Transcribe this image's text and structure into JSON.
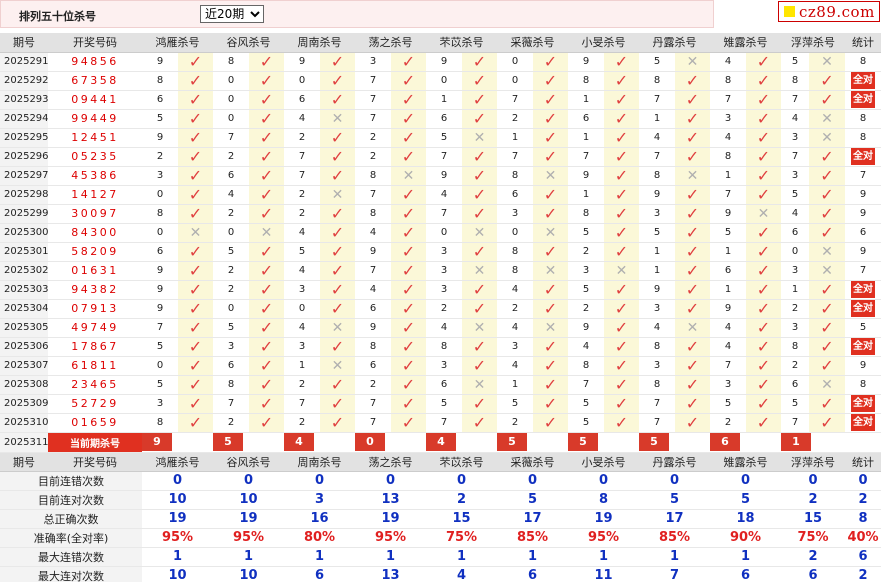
{
  "header": {
    "title": "排列五十位杀号",
    "range_select": "近20期"
  },
  "logo": {
    "text": "cz89.com"
  },
  "columns": [
    "期号",
    "开奖号码",
    "鸿雁杀号",
    "谷风杀号",
    "周南杀号",
    "荡之杀号",
    "芣苡杀号",
    "采薇杀号",
    "小旻杀号",
    "丹露杀号",
    "雉露杀号",
    "浮萍杀号",
    "统计"
  ],
  "all_correct_label": "全对",
  "rows": [
    {
      "period": "2025291",
      "draw": "94856",
      "cells": [
        [
          9,
          1
        ],
        [
          8,
          1
        ],
        [
          9,
          1
        ],
        [
          3,
          1
        ],
        [
          9,
          1
        ],
        [
          0,
          1
        ],
        [
          9,
          1
        ],
        [
          5,
          0
        ],
        [
          4,
          1
        ],
        [
          5,
          0
        ]
      ],
      "tally": "8"
    },
    {
      "period": "2025292",
      "draw": "67358",
      "cells": [
        [
          8,
          1
        ],
        [
          0,
          1
        ],
        [
          0,
          1
        ],
        [
          7,
          1
        ],
        [
          0,
          1
        ],
        [
          0,
          1
        ],
        [
          8,
          1
        ],
        [
          8,
          1
        ],
        [
          8,
          1
        ],
        [
          8,
          1
        ]
      ],
      "tally": "全对"
    },
    {
      "period": "2025293",
      "draw": "09441",
      "cells": [
        [
          6,
          1
        ],
        [
          0,
          1
        ],
        [
          6,
          1
        ],
        [
          7,
          1
        ],
        [
          1,
          1
        ],
        [
          7,
          1
        ],
        [
          1,
          1
        ],
        [
          7,
          1
        ],
        [
          7,
          1
        ],
        [
          7,
          1
        ]
      ],
      "tally": "全对"
    },
    {
      "period": "2025294",
      "draw": "99449",
      "cells": [
        [
          5,
          1
        ],
        [
          0,
          1
        ],
        [
          4,
          0
        ],
        [
          7,
          1
        ],
        [
          6,
          1
        ],
        [
          2,
          1
        ],
        [
          6,
          1
        ],
        [
          1,
          1
        ],
        [
          3,
          1
        ],
        [
          4,
          0
        ]
      ],
      "tally": "8"
    },
    {
      "period": "2025295",
      "draw": "12451",
      "cells": [
        [
          9,
          1
        ],
        [
          7,
          1
        ],
        [
          2,
          1
        ],
        [
          2,
          1
        ],
        [
          5,
          0
        ],
        [
          1,
          1
        ],
        [
          1,
          1
        ],
        [
          4,
          1
        ],
        [
          4,
          1
        ],
        [
          3,
          0
        ]
      ],
      "tally": "8"
    },
    {
      "period": "2025296",
      "draw": "05235",
      "cells": [
        [
          2,
          1
        ],
        [
          2,
          1
        ],
        [
          7,
          1
        ],
        [
          2,
          1
        ],
        [
          7,
          1
        ],
        [
          7,
          1
        ],
        [
          7,
          1
        ],
        [
          7,
          1
        ],
        [
          8,
          1
        ],
        [
          7,
          1
        ]
      ],
      "tally": "全对"
    },
    {
      "period": "2025297",
      "draw": "45386",
      "cells": [
        [
          3,
          1
        ],
        [
          6,
          1
        ],
        [
          7,
          1
        ],
        [
          8,
          0
        ],
        [
          9,
          1
        ],
        [
          8,
          0
        ],
        [
          9,
          1
        ],
        [
          8,
          0
        ],
        [
          1,
          1
        ],
        [
          3,
          1
        ]
      ],
      "tally": "7"
    },
    {
      "period": "2025298",
      "draw": "14127",
      "cells": [
        [
          0,
          1
        ],
        [
          4,
          1
        ],
        [
          2,
          0
        ],
        [
          7,
          1
        ],
        [
          4,
          1
        ],
        [
          6,
          1
        ],
        [
          1,
          1
        ],
        [
          9,
          1
        ],
        [
          7,
          1
        ],
        [
          5,
          1
        ]
      ],
      "tally": "9"
    },
    {
      "period": "2025299",
      "draw": "30097",
      "cells": [
        [
          8,
          1
        ],
        [
          2,
          1
        ],
        [
          2,
          1
        ],
        [
          8,
          1
        ],
        [
          7,
          1
        ],
        [
          3,
          1
        ],
        [
          8,
          1
        ],
        [
          3,
          1
        ],
        [
          9,
          0
        ],
        [
          4,
          1
        ]
      ],
      "tally": "9"
    },
    {
      "period": "2025300",
      "draw": "84300",
      "cells": [
        [
          0,
          0
        ],
        [
          0,
          0
        ],
        [
          4,
          1
        ],
        [
          4,
          1
        ],
        [
          0,
          0
        ],
        [
          0,
          0
        ],
        [
          5,
          1
        ],
        [
          5,
          1
        ],
        [
          5,
          1
        ],
        [
          6,
          1
        ]
      ],
      "tally": "6"
    },
    {
      "period": "2025301",
      "draw": "58209",
      "cells": [
        [
          6,
          1
        ],
        [
          5,
          1
        ],
        [
          5,
          1
        ],
        [
          9,
          1
        ],
        [
          3,
          1
        ],
        [
          8,
          1
        ],
        [
          2,
          1
        ],
        [
          1,
          1
        ],
        [
          1,
          1
        ],
        [
          0,
          0
        ]
      ],
      "tally": "9"
    },
    {
      "period": "2025302",
      "draw": "01631",
      "cells": [
        [
          9,
          1
        ],
        [
          2,
          1
        ],
        [
          4,
          1
        ],
        [
          7,
          1
        ],
        [
          3,
          0
        ],
        [
          8,
          0
        ],
        [
          3,
          0
        ],
        [
          1,
          1
        ],
        [
          6,
          1
        ],
        [
          3,
          0
        ]
      ],
      "tally": "7"
    },
    {
      "period": "2025303",
      "draw": "94382",
      "cells": [
        [
          9,
          1
        ],
        [
          2,
          1
        ],
        [
          3,
          1
        ],
        [
          4,
          1
        ],
        [
          3,
          1
        ],
        [
          4,
          1
        ],
        [
          5,
          1
        ],
        [
          9,
          1
        ],
        [
          1,
          1
        ],
        [
          1,
          1
        ]
      ],
      "tally": "全对"
    },
    {
      "period": "2025304",
      "draw": "07913",
      "cells": [
        [
          9,
          1
        ],
        [
          0,
          1
        ],
        [
          0,
          1
        ],
        [
          6,
          1
        ],
        [
          2,
          1
        ],
        [
          2,
          1
        ],
        [
          2,
          1
        ],
        [
          3,
          1
        ],
        [
          9,
          1
        ],
        [
          2,
          1
        ]
      ],
      "tally": "全对"
    },
    {
      "period": "2025305",
      "draw": "49749",
      "cells": [
        [
          7,
          1
        ],
        [
          5,
          1
        ],
        [
          4,
          0
        ],
        [
          9,
          1
        ],
        [
          4,
          0
        ],
        [
          4,
          0
        ],
        [
          9,
          1
        ],
        [
          4,
          0
        ],
        [
          4,
          1
        ],
        [
          3,
          1
        ]
      ],
      "tally": "5"
    },
    {
      "period": "2025306",
      "draw": "17867",
      "cells": [
        [
          5,
          1
        ],
        [
          3,
          1
        ],
        [
          3,
          1
        ],
        [
          8,
          1
        ],
        [
          8,
          1
        ],
        [
          3,
          1
        ],
        [
          4,
          1
        ],
        [
          8,
          1
        ],
        [
          4,
          1
        ],
        [
          8,
          1
        ]
      ],
      "tally": "全对"
    },
    {
      "period": "2025307",
      "draw": "61811",
      "cells": [
        [
          0,
          1
        ],
        [
          6,
          1
        ],
        [
          1,
          0
        ],
        [
          6,
          1
        ],
        [
          3,
          1
        ],
        [
          4,
          1
        ],
        [
          8,
          1
        ],
        [
          3,
          1
        ],
        [
          7,
          1
        ],
        [
          2,
          1
        ]
      ],
      "tally": "9"
    },
    {
      "period": "2025308",
      "draw": "23465",
      "cells": [
        [
          5,
          1
        ],
        [
          8,
          1
        ],
        [
          2,
          1
        ],
        [
          2,
          1
        ],
        [
          6,
          0
        ],
        [
          1,
          1
        ],
        [
          7,
          1
        ],
        [
          8,
          1
        ],
        [
          3,
          1
        ],
        [
          6,
          0
        ]
      ],
      "tally": "8"
    },
    {
      "period": "2025309",
      "draw": "52729",
      "cells": [
        [
          3,
          1
        ],
        [
          7,
          1
        ],
        [
          7,
          1
        ],
        [
          7,
          1
        ],
        [
          5,
          1
        ],
        [
          5,
          1
        ],
        [
          5,
          1
        ],
        [
          7,
          1
        ],
        [
          5,
          1
        ],
        [
          5,
          1
        ]
      ],
      "tally": "全对"
    },
    {
      "period": "2025310",
      "draw": "01659",
      "cells": [
        [
          8,
          1
        ],
        [
          2,
          1
        ],
        [
          2,
          1
        ],
        [
          7,
          1
        ],
        [
          7,
          1
        ],
        [
          2,
          1
        ],
        [
          5,
          1
        ],
        [
          7,
          1
        ],
        [
          2,
          1
        ],
        [
          7,
          1
        ]
      ],
      "tally": "全对"
    }
  ],
  "current": {
    "period": "2025311",
    "label": "当前期杀号",
    "picks": [
      "9",
      "5",
      "4",
      "0",
      "4",
      "5",
      "5",
      "5",
      "6",
      "1"
    ]
  },
  "stats": [
    {
      "label": "目前连错次数",
      "values": [
        "0",
        "0",
        "0",
        "0",
        "0",
        "0",
        "0",
        "0",
        "0",
        "0"
      ],
      "tally": "0",
      "pct": false
    },
    {
      "label": "目前连对次数",
      "values": [
        "10",
        "10",
        "3",
        "13",
        "2",
        "5",
        "8",
        "5",
        "5",
        "2"
      ],
      "tally": "2",
      "pct": false
    },
    {
      "label": "总正确次数",
      "values": [
        "19",
        "19",
        "16",
        "19",
        "15",
        "17",
        "19",
        "17",
        "18",
        "15"
      ],
      "tally": "8",
      "pct": false
    },
    {
      "label": "准确率(全对率)",
      "values": [
        "95%",
        "95%",
        "80%",
        "95%",
        "75%",
        "85%",
        "95%",
        "85%",
        "90%",
        "75%"
      ],
      "tally": "40%",
      "pct": true
    },
    {
      "label": "最大连错次数",
      "values": [
        "1",
        "1",
        "1",
        "1",
        "1",
        "1",
        "1",
        "1",
        "1",
        "2"
      ],
      "tally": "6",
      "pct": false
    },
    {
      "label": "最大连对次数",
      "values": [
        "10",
        "10",
        "6",
        "13",
        "4",
        "6",
        "11",
        "7",
        "6",
        "6"
      ],
      "tally": "2",
      "pct": false
    }
  ],
  "colors": {
    "accent_red": "#e03020",
    "stat_blue": "#1030c0",
    "mark_bg": "#fbf8d8"
  }
}
